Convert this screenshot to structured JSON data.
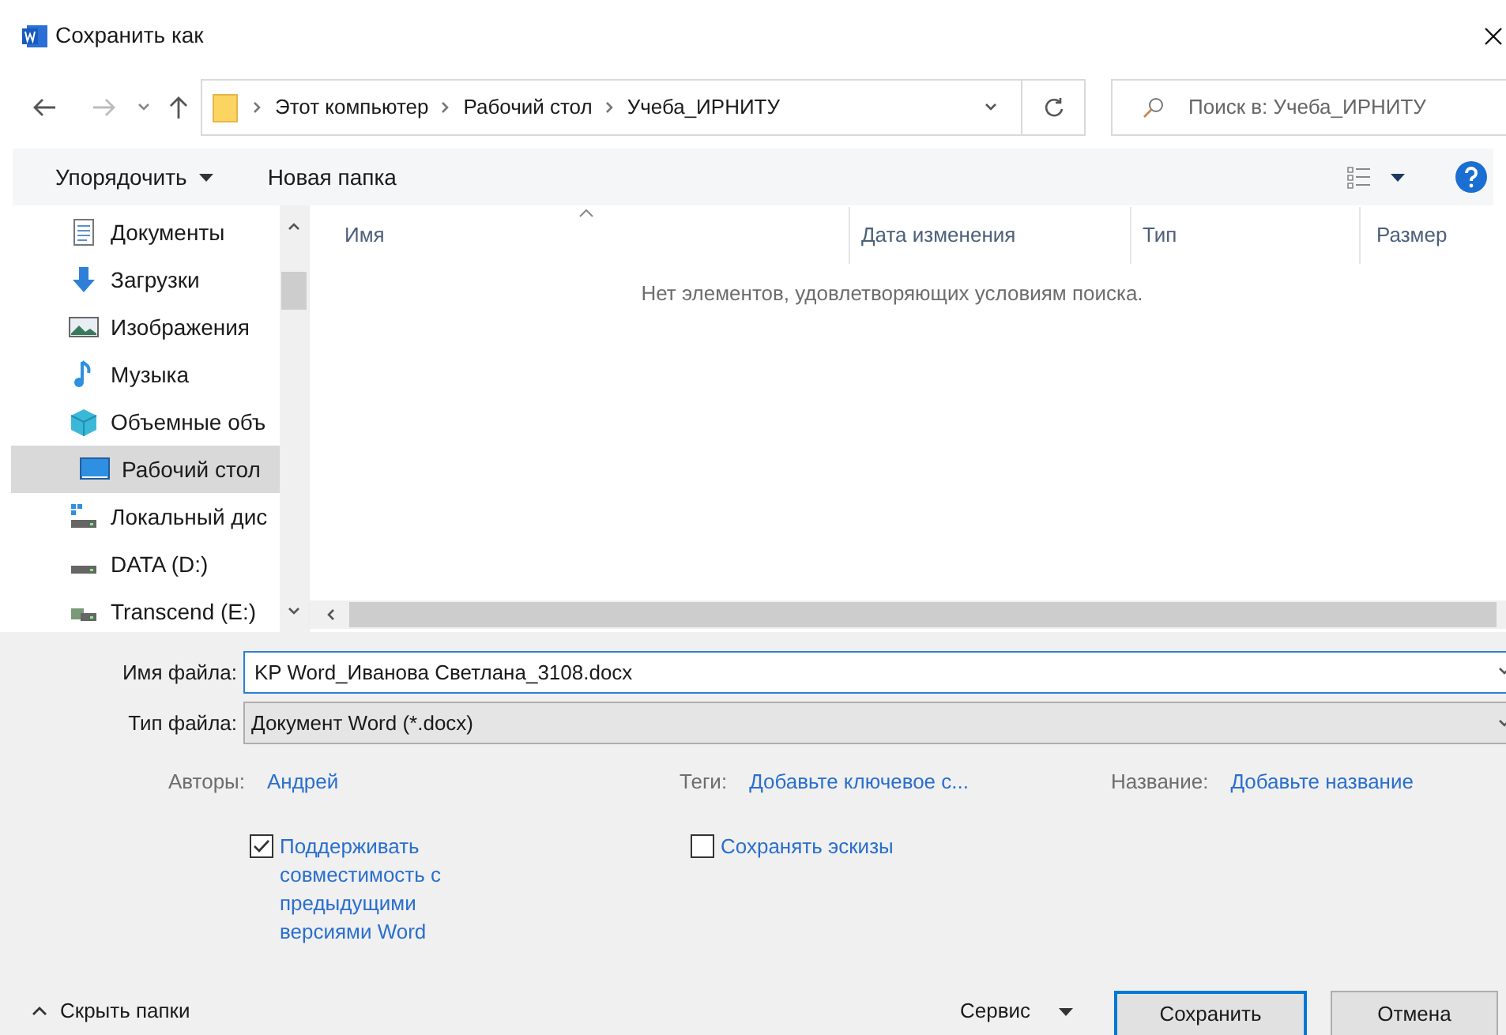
{
  "window": {
    "title": "Сохранить как"
  },
  "navigation": {
    "path": [
      {
        "label": "Этот компьютер"
      },
      {
        "label": "Рабочий стол"
      },
      {
        "label": "Учеба_ИРНИТУ"
      }
    ],
    "search": {
      "placeholder": "Поиск в: Учеба_ИРНИТУ"
    }
  },
  "toolbar": {
    "organize": "Упорядочить",
    "new_folder": "Новая папка"
  },
  "sidebar": {
    "items": [
      {
        "label": "Документы",
        "kind": "documents",
        "selected": false
      },
      {
        "label": "Загрузки",
        "kind": "downloads",
        "selected": false
      },
      {
        "label": "Изображения",
        "kind": "pictures",
        "selected": false
      },
      {
        "label": "Музыка",
        "kind": "music",
        "selected": false
      },
      {
        "label": "Объемные объ",
        "kind": "objects",
        "selected": false
      },
      {
        "label": "Рабочий стол",
        "kind": "desktop",
        "selected": true
      },
      {
        "label": "Локальный дис",
        "kind": "system_disk",
        "selected": false
      },
      {
        "label": "DATA (D:)",
        "kind": "drive",
        "selected": false
      },
      {
        "label": "Transcend (E:)",
        "kind": "usb",
        "selected": false
      }
    ]
  },
  "file_list": {
    "columns": [
      "Имя",
      "Дата изменения",
      "Тип",
      "Размер"
    ],
    "empty_message": "Нет элементов, удовлетворяющих условиям поиска."
  },
  "form": {
    "file_name": {
      "label": "Имя файла:",
      "value": "KP Word_Иванова Светлана_3108.docx"
    },
    "file_type": {
      "label": "Тип файла:",
      "value": "Документ Word (*.docx)"
    }
  },
  "metadata": [
    {
      "label": "Авторы:",
      "value": "Андрей"
    },
    {
      "label": "Теги:",
      "value": "Добавьте ключевое с..."
    },
    {
      "label": "Название:",
      "value": "Добавьте название"
    }
  ],
  "options": [
    {
      "label": "Поддерживать совместимость с предыдущими версиями Word",
      "checked": true
    },
    {
      "label": "Сохранять эскизы",
      "checked": false
    }
  ],
  "footer": {
    "hide_folders": "Скрыть папки",
    "tools": "Сервис",
    "buttons": [
      {
        "label": "Сохранить",
        "default": true
      },
      {
        "label": "Отмена",
        "default": false
      }
    ]
  }
}
